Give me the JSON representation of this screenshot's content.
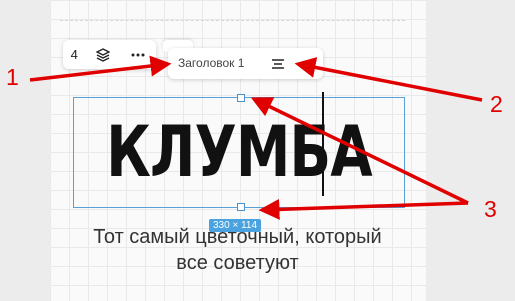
{
  "toolbar": {
    "layer_count": "4",
    "layers_icon": "layers-icon",
    "more_icon": "more-horizontal-icon"
  },
  "text_toolbar": {
    "style_label": "Заголовок 1",
    "align_icon": "align-center-icon",
    "link_icon": "link-icon"
  },
  "block": {
    "headline": "КЛУМБА",
    "size_label": "330 × 114",
    "subtitle_line1": "Тот самый цветочный, который",
    "subtitle_line2": "все советуют"
  },
  "annotations": {
    "markers": [
      "1",
      "2",
      "3"
    ],
    "color": "#e00000"
  },
  "colors": {
    "selection": "#5aa0d8",
    "badge": "#4aa3e0"
  }
}
